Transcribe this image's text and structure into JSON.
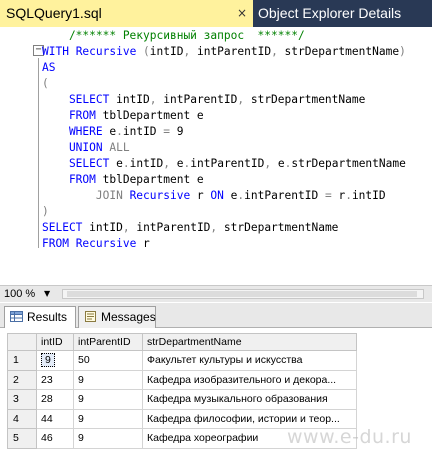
{
  "tabs": {
    "active": {
      "label": "SQLQuery1.sql",
      "close_glyph": "×"
    },
    "inactive": {
      "label": "Object Explorer Details"
    }
  },
  "editor": {
    "lines": [
      {
        "segments": [
          {
            "t": "    /****** Рекурсивный запрос  ******/",
            "c": "cm"
          }
        ]
      },
      {
        "segments": [
          {
            "t": "WITH ",
            "c": "kw"
          },
          {
            "t": "Recursive ",
            "c": "kw"
          },
          {
            "t": "(",
            "c": "gray"
          },
          {
            "t": "intID",
            "c": ""
          },
          {
            "t": ", ",
            "c": "gray"
          },
          {
            "t": "intParentID",
            "c": ""
          },
          {
            "t": ", ",
            "c": "gray"
          },
          {
            "t": "strDepartmentName",
            "c": ""
          },
          {
            "t": ")",
            "c": "gray"
          }
        ]
      },
      {
        "segments": [
          {
            "t": "AS",
            "c": "kw"
          }
        ]
      },
      {
        "segments": [
          {
            "t": "(",
            "c": "gray"
          }
        ]
      },
      {
        "segments": [
          {
            "t": "    SELECT ",
            "c": "kw"
          },
          {
            "t": "intID",
            "c": ""
          },
          {
            "t": ", ",
            "c": "gray"
          },
          {
            "t": "intParentID",
            "c": ""
          },
          {
            "t": ", ",
            "c": "gray"
          },
          {
            "t": "strDepartmentName",
            "c": ""
          }
        ]
      },
      {
        "segments": [
          {
            "t": "    FROM ",
            "c": "kw"
          },
          {
            "t": "tblDepartment e",
            "c": ""
          }
        ]
      },
      {
        "segments": [
          {
            "t": "    WHERE ",
            "c": "kw"
          },
          {
            "t": "e",
            "c": ""
          },
          {
            "t": ".",
            "c": "gray"
          },
          {
            "t": "intID ",
            "c": ""
          },
          {
            "t": "= ",
            "c": "gray"
          },
          {
            "t": "9",
            "c": ""
          }
        ]
      },
      {
        "segments": [
          {
            "t": "    UNION ",
            "c": "kw"
          },
          {
            "t": "ALL",
            "c": "gray"
          }
        ]
      },
      {
        "segments": [
          {
            "t": "    SELECT ",
            "c": "kw"
          },
          {
            "t": "e",
            "c": ""
          },
          {
            "t": ".",
            "c": "gray"
          },
          {
            "t": "intID",
            "c": ""
          },
          {
            "t": ", ",
            "c": "gray"
          },
          {
            "t": "e",
            "c": ""
          },
          {
            "t": ".",
            "c": "gray"
          },
          {
            "t": "intParentID",
            "c": ""
          },
          {
            "t": ", ",
            "c": "gray"
          },
          {
            "t": "e",
            "c": ""
          },
          {
            "t": ".",
            "c": "gray"
          },
          {
            "t": "strDepartmentName",
            "c": ""
          }
        ]
      },
      {
        "segments": [
          {
            "t": "    FROM ",
            "c": "kw"
          },
          {
            "t": "tblDepartment e",
            "c": ""
          }
        ]
      },
      {
        "segments": [
          {
            "t": "        JOIN ",
            "c": "gray"
          },
          {
            "t": "Recursive ",
            "c": "kw"
          },
          {
            "t": "r ",
            "c": ""
          },
          {
            "t": "ON ",
            "c": "kw"
          },
          {
            "t": "e",
            "c": ""
          },
          {
            "t": ".",
            "c": "gray"
          },
          {
            "t": "intParentID ",
            "c": ""
          },
          {
            "t": "= ",
            "c": "gray"
          },
          {
            "t": "r",
            "c": ""
          },
          {
            "t": ".",
            "c": "gray"
          },
          {
            "t": "intID",
            "c": ""
          }
        ]
      },
      {
        "segments": [
          {
            "t": ")",
            "c": "gray"
          }
        ]
      },
      {
        "segments": [
          {
            "t": "SELECT ",
            "c": "kw"
          },
          {
            "t": "intID",
            "c": ""
          },
          {
            "t": ", ",
            "c": "gray"
          },
          {
            "t": "intParentID",
            "c": ""
          },
          {
            "t": ", ",
            "c": "gray"
          },
          {
            "t": "strDepartmentName",
            "c": ""
          }
        ]
      },
      {
        "segments": [
          {
            "t": "FROM ",
            "c": "kw"
          },
          {
            "t": "Recursive ",
            "c": "kw"
          },
          {
            "t": "r",
            "c": ""
          }
        ]
      }
    ],
    "fold_glyph": "−",
    "colors": {
      "keyword": "#0000ff",
      "operator": "#808080",
      "comment": "#008000"
    }
  },
  "statusbar": {
    "zoom": "100 %",
    "zoom_arrow": "▼"
  },
  "results": {
    "tabs": [
      {
        "label": "Results",
        "icon": "grid-icon"
      },
      {
        "label": "Messages",
        "icon": "messages-icon"
      }
    ],
    "columns": [
      "intID",
      "intParentID",
      "strDepartmentName"
    ],
    "rows": [
      {
        "n": "1",
        "intID": "9",
        "intParentID": "50",
        "strDepartmentName": "Факультет культуры и искусства"
      },
      {
        "n": "2",
        "intID": "23",
        "intParentID": "9",
        "strDepartmentName": "Кафедра изобразительного и декора..."
      },
      {
        "n": "3",
        "intID": "28",
        "intParentID": "9",
        "strDepartmentName": "Кафедра музыкального образования"
      },
      {
        "n": "4",
        "intID": "44",
        "intParentID": "9",
        "strDepartmentName": "Кафедра философии, истории и теор..."
      },
      {
        "n": "5",
        "intID": "46",
        "intParentID": "9",
        "strDepartmentName": "Кафедра хореографии"
      }
    ]
  },
  "watermark": "www.e-du.ru",
  "colors": {
    "tab_active_bg": "#fff29d",
    "tabstrip_bg": "#293955"
  }
}
